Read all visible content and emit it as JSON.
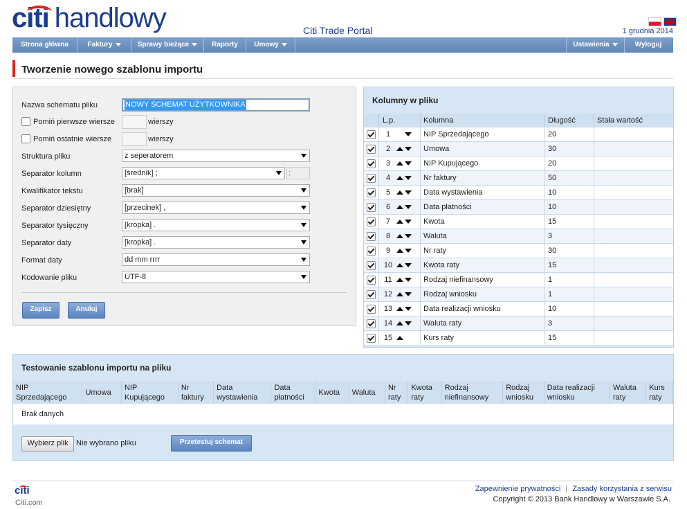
{
  "header": {
    "logo_citi": "citi",
    "logo_handlowy": "handlowy",
    "portal_title": "Citi Trade Portal",
    "date": "1 grudnia 2014",
    "brand_color": "#1b3d8f",
    "accent_color": "#d9261c"
  },
  "nav": {
    "items": [
      {
        "label": "Strona główna",
        "dropdown": false
      },
      {
        "label": "Faktury",
        "dropdown": true
      },
      {
        "label": "Sprawy bieżące",
        "dropdown": true
      },
      {
        "label": "Raporty",
        "dropdown": false
      },
      {
        "label": "Umowy",
        "dropdown": true
      }
    ],
    "settings": "Ustawienia",
    "logout": "Wyloguj"
  },
  "page": {
    "title": "Tworzenie nowego szablonu importu"
  },
  "form": {
    "name_label": "Nazwa schematu pliku",
    "name_value": "NOWY SCHEMAT UŻYTKOWNIKA",
    "skip_first_label": "Pomiń pierwsze wiersze",
    "skip_last_label": "Pomiń ostatnie wiersze",
    "rows_unit": "wierszy",
    "structure_label": "Struktura pliku",
    "structure_value": "z seperatorem",
    "col_sep_label": "Separator kolumn",
    "col_sep_value": "[średnik] ;",
    "col_sep_char": ";",
    "text_qual_label": "Kwalifikator tekstu",
    "text_qual_value": "[brak]",
    "dec_sep_label": "Separator dziesiętny",
    "dec_sep_value": "[przecinek] ,",
    "thou_sep_label": "Separator tysięczny",
    "thou_sep_value": "[kropka] .",
    "date_sep_label": "Separator daty",
    "date_sep_value": "[kropka] .",
    "date_fmt_label": "Format daty",
    "date_fmt_value": "dd mm rrrr",
    "encoding_label": "Kodowanie pliku",
    "encoding_value": "UTF-8",
    "save": "Zapisz",
    "cancel": "Anuluj"
  },
  "columns_panel": {
    "title": "Kolumny w pliku",
    "headers": {
      "lp": "L.p.",
      "column": "Kolumna",
      "length": "Długość",
      "const": "Stała wartość"
    },
    "rows": [
      {
        "lp": "1",
        "name": "NIP Sprzedającego",
        "length": "20"
      },
      {
        "lp": "2",
        "name": "Umowa",
        "length": "30"
      },
      {
        "lp": "3",
        "name": "NIP Kupującego",
        "length": "20"
      },
      {
        "lp": "4",
        "name": "Nr faktury",
        "length": "50"
      },
      {
        "lp": "5",
        "name": "Data wystawienia",
        "length": "10"
      },
      {
        "lp": "6",
        "name": "Data płatności",
        "length": "10"
      },
      {
        "lp": "7",
        "name": "Kwota",
        "length": "15"
      },
      {
        "lp": "8",
        "name": "Waluta",
        "length": "3"
      },
      {
        "lp": "9",
        "name": "Nr raty",
        "length": "30"
      },
      {
        "lp": "10",
        "name": "Kwota raty",
        "length": "15"
      },
      {
        "lp": "11",
        "name": "Rodzaj niefinansowy",
        "length": "1"
      },
      {
        "lp": "12",
        "name": "Rodzaj wniosku",
        "length": "1"
      },
      {
        "lp": "13",
        "name": "Data realizacji wniosku",
        "length": "10"
      },
      {
        "lp": "14",
        "name": "Waluta raty",
        "length": "3"
      },
      {
        "lp": "15",
        "name": "Kurs raty",
        "length": "15"
      }
    ]
  },
  "test_panel": {
    "title": "Testowanie szablonu importu na pliku",
    "headers": [
      [
        "NIP",
        "Sprzedającego"
      ],
      [
        "Umowa"
      ],
      [
        "NIP",
        "Kupującego"
      ],
      [
        "Nr",
        "faktury"
      ],
      [
        "Data",
        "wystawienia"
      ],
      [
        "Data",
        "płatności"
      ],
      [
        "Kwota"
      ],
      [
        "Waluta"
      ],
      [
        "Nr",
        "raty"
      ],
      [
        "Kwota",
        "raty"
      ],
      [
        "Rodzaj",
        "niefinansowy"
      ],
      [
        "Rodzaj",
        "wniosku"
      ],
      [
        "Data realizacji",
        "wniosku"
      ],
      [
        "Waluta",
        "raty"
      ],
      [
        "Kurs",
        "raty"
      ]
    ],
    "no_data": "Brak danych",
    "choose_file": "Wybierz plik",
    "no_file": "Nie wybrano pliku",
    "test_button": "Przetestuj schemat"
  },
  "footer": {
    "logo": "citi",
    "site": "Citi.com",
    "privacy": "Zapewnienie prywatności",
    "separator": "|",
    "terms": "Zasady korzystania z serwisu",
    "copyright": "Copyright © 2013 Bank Handlowy w Warszawie S.A."
  }
}
